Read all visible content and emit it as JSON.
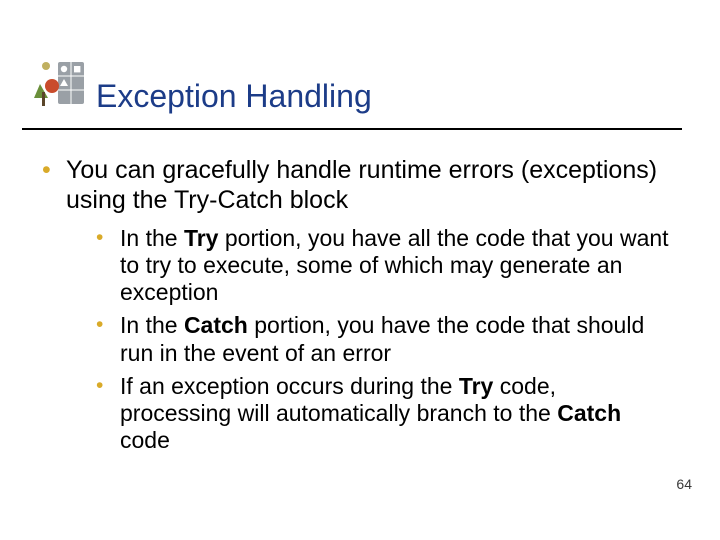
{
  "title": "Exception Handling",
  "bullets": {
    "main": "You can gracefully handle runtime errors (exceptions) using the Try-Catch block",
    "sub1_pre": "In the ",
    "sub1_b": "Try",
    "sub1_post": " portion, you have all the code that you want to try to execute, some of which may generate an exception",
    "sub2_pre": "In the ",
    "sub2_b": "Catch",
    "sub2_post": " portion, you have the code that should run in the event of an error",
    "sub3_pre": "If an exception occurs during the ",
    "sub3_b1": "Try",
    "sub3_mid": " code, processing will automatically branch to the ",
    "sub3_b2": "Catch",
    "sub3_post": " code"
  },
  "page_number": "64"
}
